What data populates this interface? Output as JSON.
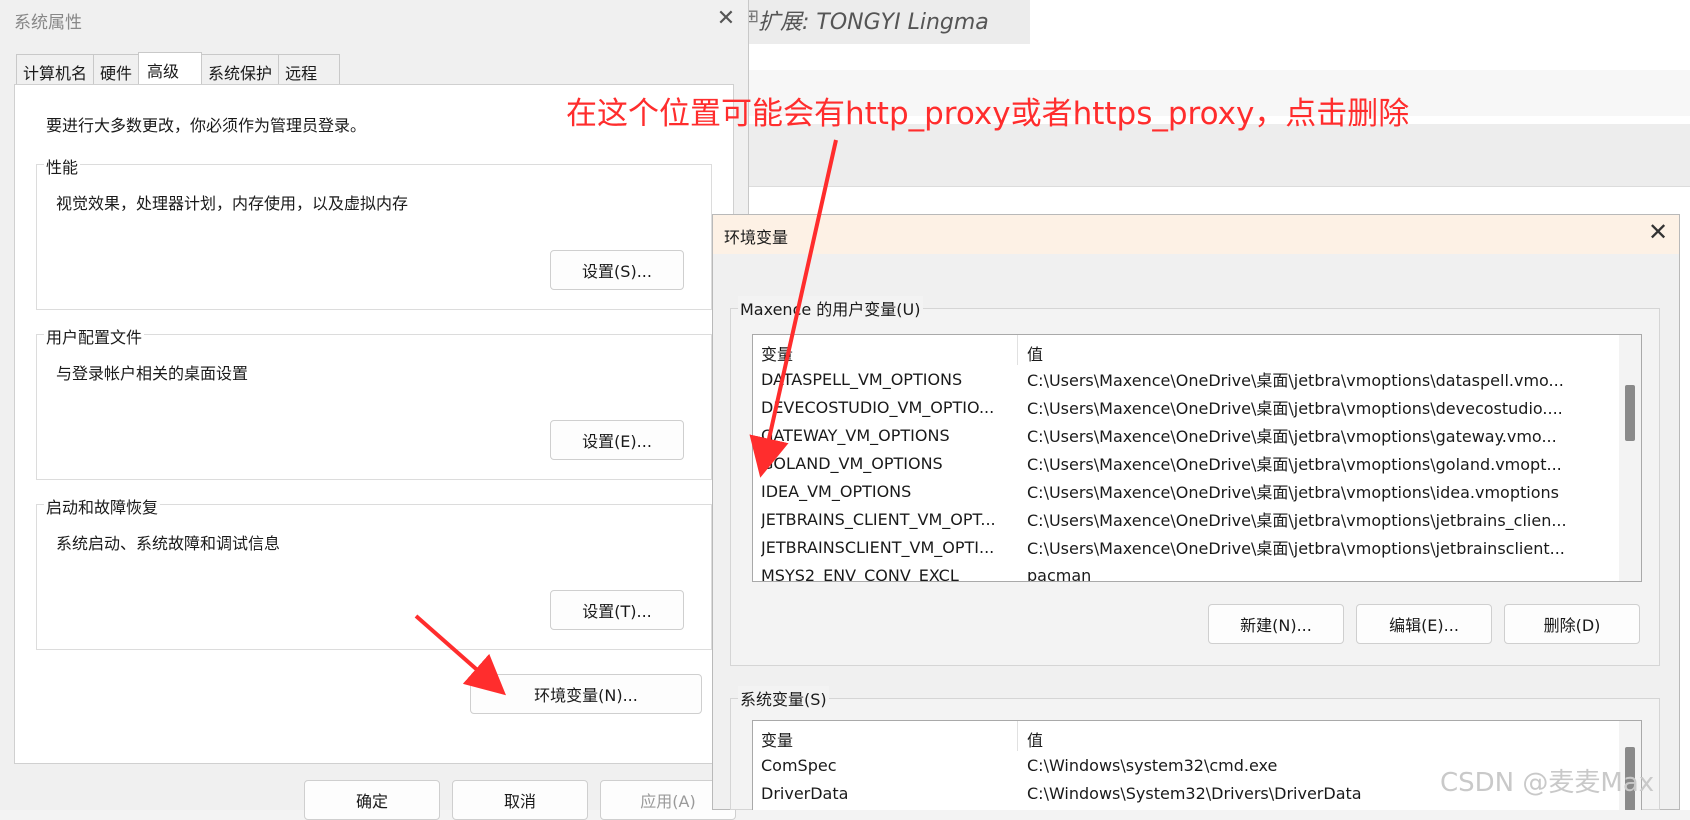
{
  "background_app": {
    "tab_label": "扩展: TONGYI Lingma",
    "tab_icon": "extensions-icon"
  },
  "system_properties": {
    "title": "系统属性",
    "tabs": [
      {
        "label": "计算机名",
        "active": false
      },
      {
        "label": "硬件",
        "active": false
      },
      {
        "label": "高级",
        "active": true
      },
      {
        "label": "系统保护",
        "active": false
      },
      {
        "label": "远程",
        "active": false
      }
    ],
    "admin_note": "要进行大多数更改，你必须作为管理员登录。",
    "groups": [
      {
        "title": "性能",
        "description": "视觉效果，处理器计划，内存使用，以及虚拟内存",
        "button": "设置(S)..."
      },
      {
        "title": "用户配置文件",
        "description": "与登录帐户相关的桌面设置",
        "button": "设置(E)..."
      },
      {
        "title": "启动和故障恢复",
        "description": "系统启动、系统故障和调试信息",
        "button": "设置(T)..."
      }
    ],
    "env_button": "环境变量(N)...",
    "bottom_buttons": [
      "确定",
      "取消",
      "应用(A)"
    ]
  },
  "env_dialog": {
    "title": "环境变量",
    "user_section_title": "Maxence 的用户变量(U)",
    "columns": [
      "变量",
      "值"
    ],
    "user_vars": [
      {
        "name": "DATASPELL_VM_OPTIONS",
        "value": "C:\\Users\\Maxence\\OneDrive\\桌面\\jetbra\\vmoptions\\dataspell.vmo..."
      },
      {
        "name": "DEVECOSTUDIO_VM_OPTIO...",
        "value": "C:\\Users\\Maxence\\OneDrive\\桌面\\jetbra\\vmoptions\\devecostudio...."
      },
      {
        "name": "GATEWAY_VM_OPTIONS",
        "value": "C:\\Users\\Maxence\\OneDrive\\桌面\\jetbra\\vmoptions\\gateway.vmo..."
      },
      {
        "name": "GOLAND_VM_OPTIONS",
        "value": "C:\\Users\\Maxence\\OneDrive\\桌面\\jetbra\\vmoptions\\goland.vmopt..."
      },
      {
        "name": "IDEA_VM_OPTIONS",
        "value": "C:\\Users\\Maxence\\OneDrive\\桌面\\jetbra\\vmoptions\\idea.vmoptions"
      },
      {
        "name": "JETBRAINS_CLIENT_VM_OPT...",
        "value": "C:\\Users\\Maxence\\OneDrive\\桌面\\jetbra\\vmoptions\\jetbrains_clien..."
      },
      {
        "name": "JETBRAINSCLIENT_VM_OPTI...",
        "value": "C:\\Users\\Maxence\\OneDrive\\桌面\\jetbra\\vmoptions\\jetbrainsclient..."
      },
      {
        "name": "MSYS2_ENV_CONV_EXCL",
        "value": "pacman"
      }
    ],
    "user_buttons": [
      "新建(N)...",
      "编辑(E)...",
      "删除(D)"
    ],
    "system_section_title": "系统变量(S)",
    "system_vars": [
      {
        "name": "ComSpec",
        "value": "C:\\Windows\\system32\\cmd.exe"
      },
      {
        "name": "DriverData",
        "value": "C:\\Windows\\System32\\Drivers\\DriverData"
      }
    ]
  },
  "annotation": {
    "text": "在这个位置可能会有http_proxy或者https_proxy，点击删除",
    "color": "#ff2d2d"
  },
  "watermark": "CSDN @麦麦Max"
}
